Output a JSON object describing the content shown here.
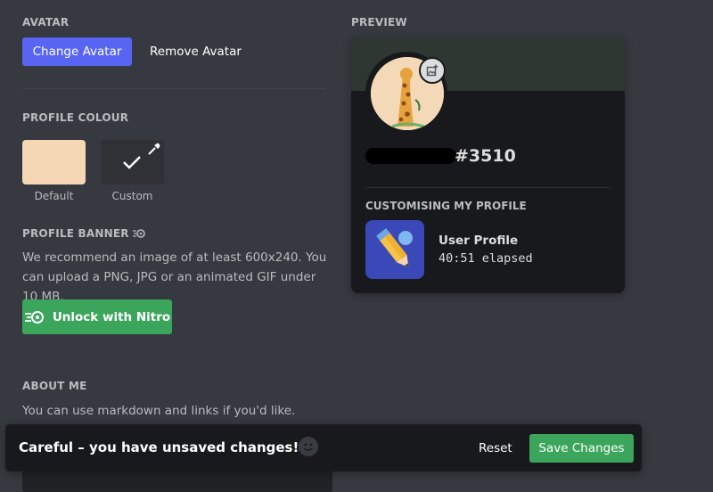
{
  "avatar": {
    "section_title": "AVATAR",
    "change_label": "Change Avatar",
    "remove_label": "Remove Avatar"
  },
  "profile_colour": {
    "section_title": "PROFILE COLOUR",
    "default_label": "Default",
    "custom_label": "Custom",
    "default_color": "#f5d7b5",
    "custom_color": "#2f3136"
  },
  "profile_banner": {
    "section_title": "PROFILE BANNER",
    "description": "We recommend an image of at least 600x240. You can upload a PNG, JPG or an animated GIF under 10 MB.",
    "unlock_label": "Unlock with Nitro"
  },
  "about_me": {
    "section_title": "ABOUT ME",
    "description": "You can use markdown and links if you'd like."
  },
  "preview": {
    "section_title": "PREVIEW",
    "banner_color": "#2f3732",
    "username_tag": "#3510",
    "activity_heading": "CUSTOMISING MY PROFILE",
    "activity_name": "User Profile",
    "activity_elapsed": "40:51 elapsed"
  },
  "unsaved": {
    "message": "Careful – you have unsaved changes!",
    "reset_label": "Reset",
    "save_label": "Save Changes"
  },
  "colors": {
    "accent": "#5865f2",
    "green": "#3ba55c",
    "background": "#36393f"
  }
}
